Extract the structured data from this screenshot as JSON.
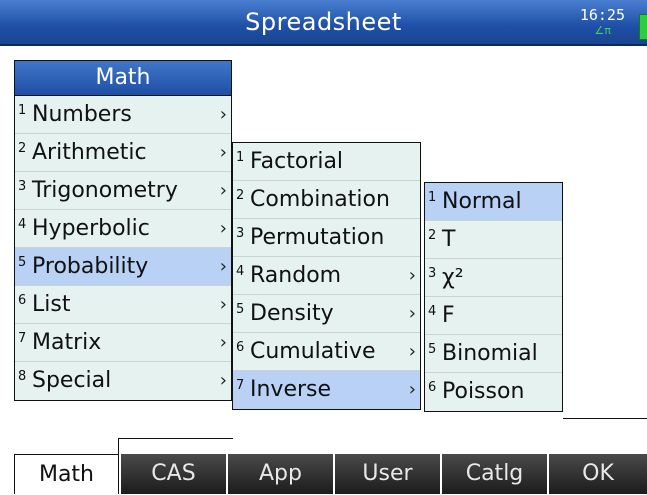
{
  "titlebar": {
    "title": "Spreadsheet",
    "clock": "16:25",
    "indicator": "∠π"
  },
  "math_menu": {
    "header": "Math",
    "items": [
      {
        "num": "1",
        "label": "Numbers"
      },
      {
        "num": "2",
        "label": "Arithmetic"
      },
      {
        "num": "3",
        "label": "Trigonometry"
      },
      {
        "num": "4",
        "label": "Hyperbolic"
      },
      {
        "num": "5",
        "label": "Probability"
      },
      {
        "num": "6",
        "label": "List"
      },
      {
        "num": "7",
        "label": "Matrix"
      },
      {
        "num": "8",
        "label": "Special"
      }
    ],
    "selected": "Probability"
  },
  "probability_menu": {
    "items": [
      {
        "num": "1",
        "label": "Factorial",
        "chevron": ""
      },
      {
        "num": "2",
        "label": "Combination",
        "chevron": ""
      },
      {
        "num": "3",
        "label": "Permutation",
        "chevron": ""
      },
      {
        "num": "4",
        "label": "Random",
        "chevron": "›"
      },
      {
        "num": "5",
        "label": "Density",
        "chevron": "›"
      },
      {
        "num": "6",
        "label": "Cumulative",
        "chevron": "›"
      },
      {
        "num": "7",
        "label": "Inverse",
        "chevron": "›"
      }
    ],
    "selected": "Inverse"
  },
  "inverse_menu": {
    "items": [
      {
        "num": "1",
        "label": "Normal"
      },
      {
        "num": "2",
        "label": "T"
      },
      {
        "num": "3",
        "label": "χ²"
      },
      {
        "num": "4",
        "label": "F"
      },
      {
        "num": "5",
        "label": "Binomial"
      },
      {
        "num": "6",
        "label": "Poisson"
      }
    ],
    "selected": "Normal"
  },
  "softkeys": {
    "math": "Math",
    "cas": "CAS",
    "app": "App",
    "user": "User",
    "catlg": "Catlg",
    "ok": "OK"
  },
  "colors": {
    "title_bar": "#1f4fa6",
    "menu_bg": "#e6f2ef",
    "highlight": "#b8d1f5",
    "softkey_dark": "#2a2a2a"
  }
}
